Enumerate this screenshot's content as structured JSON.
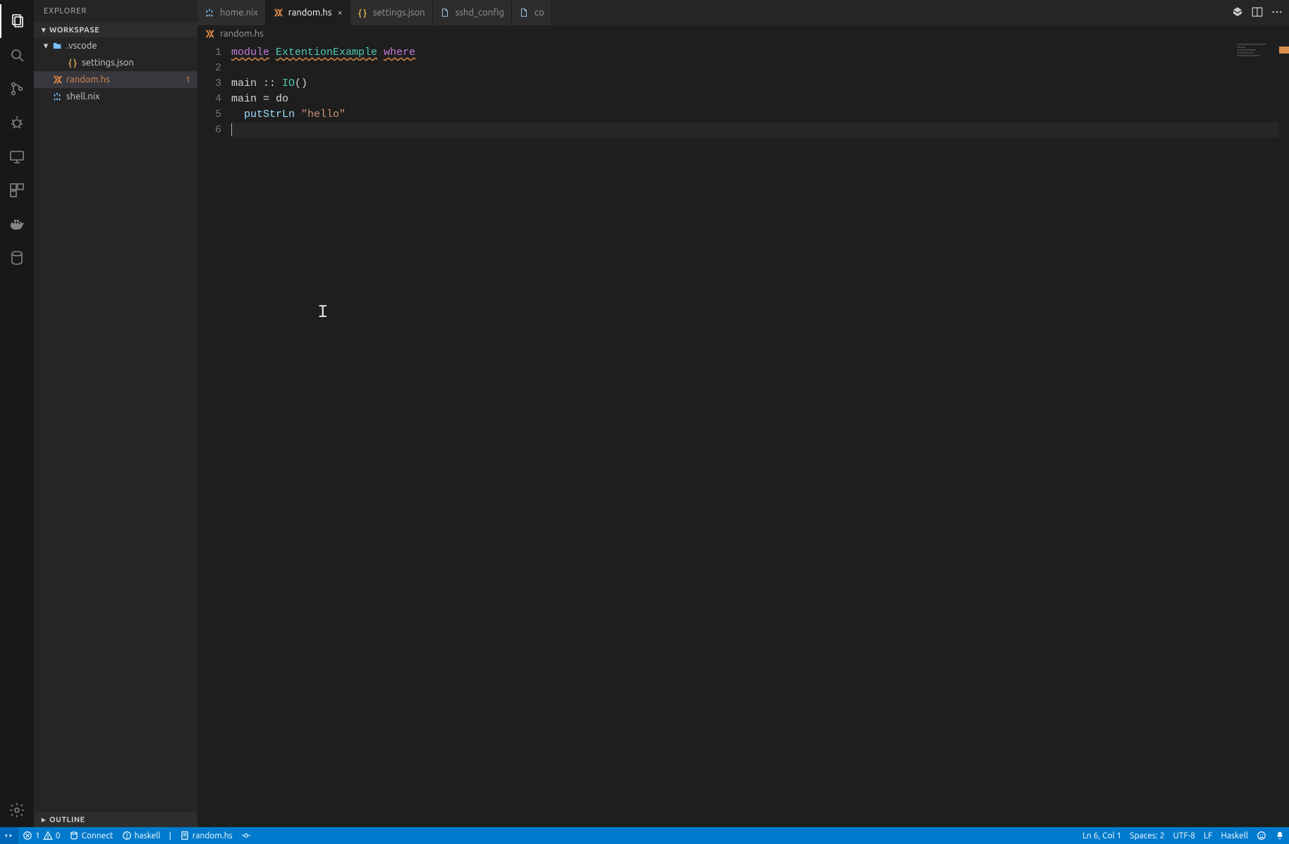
{
  "explorer": {
    "title": "EXPLORER",
    "workspace_label": "WORKSPASE",
    "outline_label": "OUTLINE",
    "tree": [
      {
        "label": ".vscode",
        "is_folder": true,
        "depth": 0,
        "expanded": true,
        "icon": "folder"
      },
      {
        "label": "settings.json",
        "is_folder": false,
        "depth": 1,
        "icon": "json"
      },
      {
        "label": "random.hs",
        "is_folder": false,
        "depth": 0,
        "icon": "haskell",
        "modified": true,
        "badge": "1",
        "active": true
      },
      {
        "label": "shell.nix",
        "is_folder": false,
        "depth": 0,
        "icon": "nix"
      }
    ]
  },
  "tabs": [
    {
      "label": "home.nix",
      "icon": "nix",
      "active": false
    },
    {
      "label": "random.hs",
      "icon": "haskell",
      "active": true,
      "closeable": true
    },
    {
      "label": "settings.json",
      "icon": "json",
      "active": false
    },
    {
      "label": "sshd_config",
      "icon": "file",
      "active": false
    },
    {
      "label": "co",
      "icon": "file",
      "active": false
    }
  ],
  "breadcrumb": {
    "file": "random.hs",
    "icon": "haskell"
  },
  "editor": {
    "lines": [
      {
        "n": 1,
        "tokens": [
          {
            "t": "module",
            "c": "tok-kw-u"
          },
          {
            "t": " ",
            "c": ""
          },
          {
            "t": "ExtentionExample",
            "c": "tok-type-u"
          },
          {
            "t": " ",
            "c": ""
          },
          {
            "t": "where",
            "c": "tok-kw-u"
          }
        ]
      },
      {
        "n": 2,
        "tokens": []
      },
      {
        "n": 3,
        "tokens": [
          {
            "t": "main",
            "c": "tok-id"
          },
          {
            "t": " :: ",
            "c": "tok-op"
          },
          {
            "t": "IO",
            "c": "tok-io"
          },
          {
            "t": "()",
            "c": "tok-op"
          }
        ]
      },
      {
        "n": 4,
        "tokens": [
          {
            "t": "main",
            "c": "tok-id"
          },
          {
            "t": " = ",
            "c": "tok-op"
          },
          {
            "t": "do",
            "c": "tok-id"
          }
        ]
      },
      {
        "n": 5,
        "tokens": [
          {
            "t": "  ",
            "c": ""
          },
          {
            "t": "putStrLn",
            "c": "tok-fn"
          },
          {
            "t": " ",
            "c": ""
          },
          {
            "t": "\"hello\"",
            "c": "tok-str"
          }
        ]
      },
      {
        "n": 6,
        "tokens": [],
        "cursor": true
      }
    ]
  },
  "status": {
    "remote": "",
    "errors": "1",
    "warnings": "0",
    "connect": "Connect",
    "lsp": "haskell",
    "file": "random.hs",
    "cursor": "Ln 6, Col 1",
    "spaces": "Spaces: 2",
    "encoding": "UTF-8",
    "eol": "LF",
    "language": "Haskell"
  }
}
